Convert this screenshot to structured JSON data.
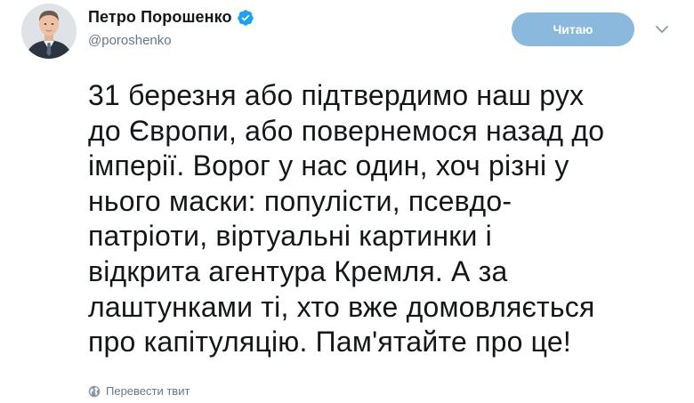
{
  "author": {
    "display_name": "Петро Порошенко",
    "handle": "@poroshenko",
    "verified": true
  },
  "follow_button": {
    "label": "Читаю"
  },
  "tweet": {
    "lines": [
      "31 березня або підтвердимо наш рух",
      "до Європи, або повернемося назад до",
      "імперії. Ворог у нас один, хоч різні у",
      "нього маски: популісти, псевдо-",
      "патріоти, віртуальні картинки і",
      "відкрита агентура Кремля. А за",
      "лаштунками ті, хто вже домовляється",
      "про капітуляцію. Пам'ятайте про це!"
    ]
  },
  "translate_link": {
    "label": "Перевести твит"
  },
  "icons": {
    "verified": "verified-badge-icon",
    "caret": "chevron-down-icon",
    "translate": "globe-icon"
  },
  "colors": {
    "accent": "#1da1f2",
    "follow_button_bg": "#8ab9dd",
    "secondary_text": "#657786",
    "primary_text": "#14171a"
  }
}
